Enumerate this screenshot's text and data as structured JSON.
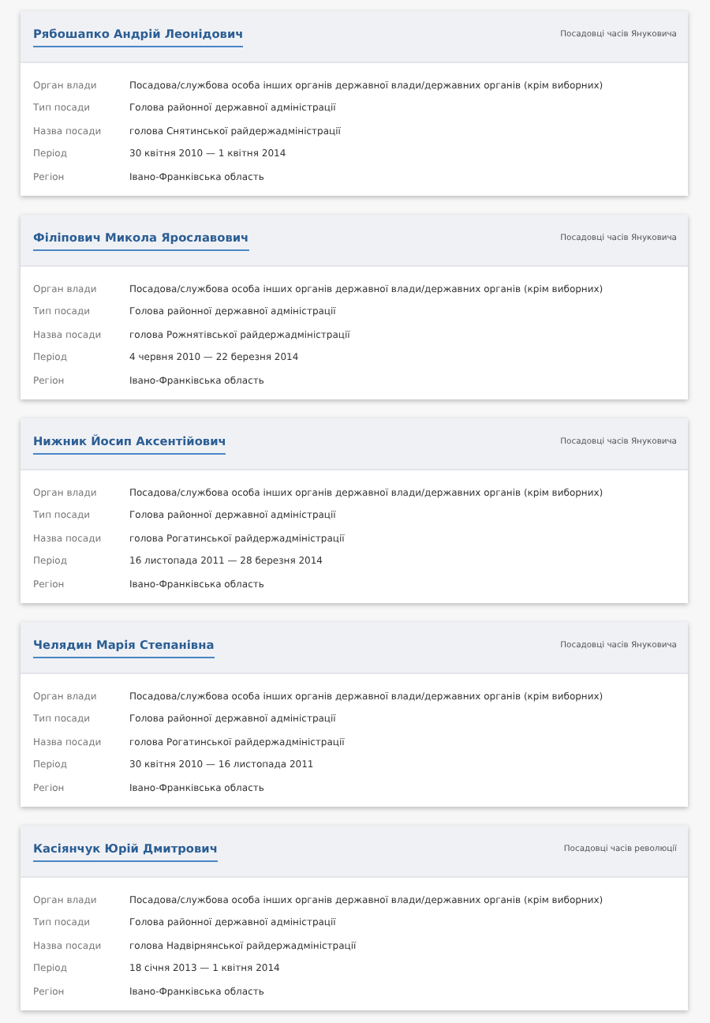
{
  "cards": [
    {
      "name": "Рябошапко Андрій Леонідович",
      "era": "Посадовці часів Януковича",
      "fields": [
        {
          "label": "Орган влади",
          "value": "Посадова/службова особа інших органів державної влади/державних органів (крім виборних)"
        },
        {
          "label": "Тип посади",
          "value": "Голова районної державної адміністрації"
        },
        {
          "label": "Назва посади",
          "value": "голова Снятинської райдержадміністрації"
        },
        {
          "label": "Період",
          "value": "30 квітня 2010 — 1 квітня 2014"
        },
        {
          "label": "Регіон",
          "value": "Івано-Франківська область"
        }
      ]
    },
    {
      "name": "Філіпович Микола Ярославович",
      "era": "Посадовці часів Януковича",
      "fields": [
        {
          "label": "Орган влади",
          "value": "Посадова/службова особа інших органів державної влади/державних органів (крім виборних)"
        },
        {
          "label": "Тип посади",
          "value": "Голова районної державної адміністрації"
        },
        {
          "label": "Назва посади",
          "value": "голова Рожнятівської райдержадміністрації"
        },
        {
          "label": "Період",
          "value": "4 червня 2010 — 22 березня 2014"
        },
        {
          "label": "Регіон",
          "value": "Івано-Франківська область"
        }
      ]
    },
    {
      "name": "Нижник Йосип Аксентійович",
      "era": "Посадовці часів Януковича",
      "fields": [
        {
          "label": "Орган влади",
          "value": "Посадова/службова особа інших органів державної влади/державних органів (крім виборних)"
        },
        {
          "label": "Тип посади",
          "value": "Голова районної державної адміністрації"
        },
        {
          "label": "Назва посади",
          "value": "голова Рогатинської райдержадміністрації"
        },
        {
          "label": "Період",
          "value": "16 листопада 2011 — 28 березня 2014"
        },
        {
          "label": "Регіон",
          "value": "Івано-Франківська область"
        }
      ]
    },
    {
      "name": "Челядин Марія Степанівна",
      "era": "Посадовці часів Януковича",
      "fields": [
        {
          "label": "Орган влади",
          "value": "Посадова/службова особа інших органів державної влади/державних органів (крім виборних)"
        },
        {
          "label": "Тип посади",
          "value": "Голова районної державної адміністрації"
        },
        {
          "label": "Назва посади",
          "value": "голова Рогатинської райдержадміністрації"
        },
        {
          "label": "Період",
          "value": "30 квітня 2010 — 16 листопада 2011"
        },
        {
          "label": "Регіон",
          "value": "Івано-Франківська область"
        }
      ]
    },
    {
      "name": "Касіянчук Юрій Дмитрович",
      "era": "Посадовці часів революції",
      "fields": [
        {
          "label": "Орган влади",
          "value": "Посадова/службова особа інших органів державної влади/державних органів (крім виборних)"
        },
        {
          "label": "Тип посади",
          "value": "Голова районної державної адміністрації"
        },
        {
          "label": "Назва посади",
          "value": "голова Надвірнянської райдержадміністрації"
        },
        {
          "label": "Період",
          "value": "18 січня 2013 — 1 квітня 2014"
        },
        {
          "label": "Регіон",
          "value": "Івано-Франківська область"
        }
      ]
    }
  ]
}
